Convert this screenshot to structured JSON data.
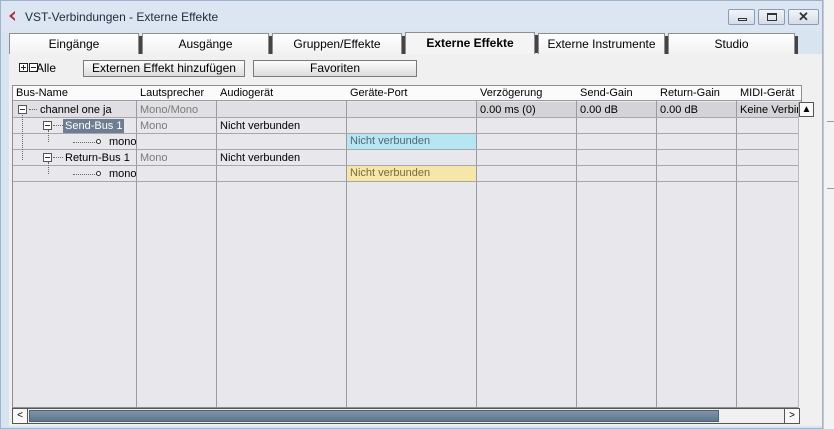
{
  "window": {
    "title": "VST-Verbindungen - Externe Effekte",
    "close_glyph": "✕",
    "accent": "#b8283a"
  },
  "tabs": [
    {
      "label": "Eingänge",
      "active": false
    },
    {
      "label": "Ausgänge",
      "active": false
    },
    {
      "label": "Gruppen/Effekte",
      "active": false
    },
    {
      "label": "Externe Effekte",
      "active": true
    },
    {
      "label": "Externe Instrumente",
      "active": false
    },
    {
      "label": "Studio",
      "active": false
    }
  ],
  "toolbar": {
    "expand_all_icons": [
      "expand-all-icon",
      "collapse-all-icon"
    ],
    "all_label": "Alle",
    "add_button_label": "Externen Effekt hinzufügen",
    "favorites_button_label": "Favoriten"
  },
  "table": {
    "columns": [
      "Bus-Name",
      "Lautsprecher",
      "Audiogerät",
      "Geräte-Port",
      "Verzögerung",
      "Send-Gain",
      "Return-Gain",
      "MIDI-Gerät"
    ],
    "rows": {
      "channel": {
        "name": "channel one ja",
        "speaker": "Mono/Mono",
        "audio_device": "",
        "port": "",
        "delay": "0.00 ms (0)",
        "send_gain": "0.00 dB",
        "return_gain": "0.00 dB",
        "midi": "Keine Verbin"
      },
      "send_bus": {
        "name": "Send-Bus 1",
        "speaker": "Mono",
        "audio_device": "Nicht verbunden"
      },
      "send_mono": {
        "name": "mono",
        "port": "Nicht verbunden"
      },
      "return_bus": {
        "name": "Return-Bus 1",
        "speaker": "Mono",
        "audio_device": "Nicht verbunden"
      },
      "return_mono": {
        "name": "mono",
        "port": "Nicht verbunden"
      }
    }
  },
  "colors": {
    "port_send": "#b7e6f2",
    "port_return": "#f6e6a8",
    "selection": "#6e7e92"
  },
  "scrollbars": {
    "up": "▲",
    "left": "<",
    "right": ">"
  }
}
